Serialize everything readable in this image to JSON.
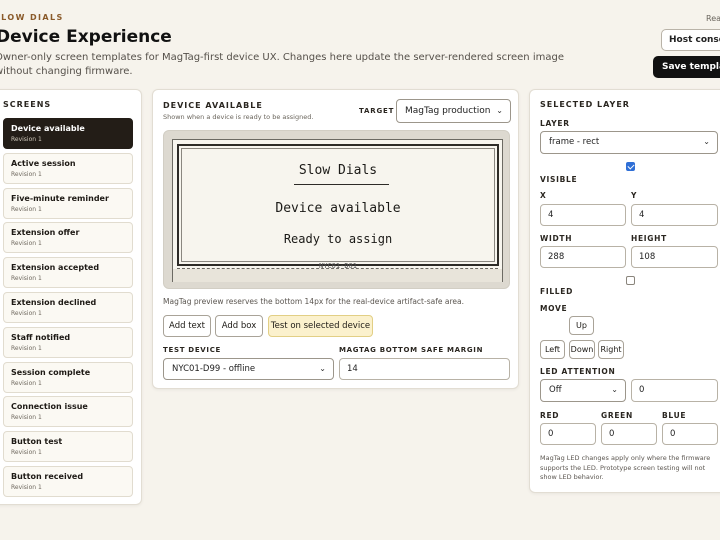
{
  "header": {
    "brand": "SLOW DIALS",
    "title": "Device Experience",
    "description": "Owner-only screen templates for MagTag-first device UX. Changes here update the server-rendered screen image without changing firmware.",
    "top_link": "Ready",
    "host_console_label": "Host console",
    "save_label": "Save templates"
  },
  "screens": {
    "label": "SCREENS",
    "items": [
      {
        "name": "Device available",
        "revision": "Revision 1",
        "active": true
      },
      {
        "name": "Active session",
        "revision": "Revision 1"
      },
      {
        "name": "Five-minute reminder",
        "revision": "Revision 1"
      },
      {
        "name": "Extension offer",
        "revision": "Revision 1"
      },
      {
        "name": "Extension accepted",
        "revision": "Revision 1"
      },
      {
        "name": "Extension declined",
        "revision": "Revision 1"
      },
      {
        "name": "Staff notified",
        "revision": "Revision 1"
      },
      {
        "name": "Session complete",
        "revision": "Revision 1"
      },
      {
        "name": "Connection issue",
        "revision": "Revision 1"
      },
      {
        "name": "Button test",
        "revision": "Revision 1"
      },
      {
        "name": "Button received",
        "revision": "Revision 1"
      }
    ]
  },
  "editor": {
    "title": "DEVICE AVAILABLE",
    "subtitle": "Shown when a device is ready to be assigned.",
    "target_label": "TARGET",
    "target_value": "MagTag production",
    "preview": {
      "title": "Slow Dials",
      "heading": "Device available",
      "subheading": "Ready to assign",
      "device_code": "NYC01-D01"
    },
    "preview_note": "MagTag preview reserves the bottom 14px for the real-device artifact-safe area.",
    "add_text_label": "Add text",
    "add_box_label": "Add box",
    "test_label": "Test on selected device",
    "test_device_label": "TEST DEVICE",
    "test_device_value": "NYC01-D99 - offline",
    "margin_label": "MAGTAG BOTTOM SAFE MARGIN",
    "margin_value": "14"
  },
  "layer": {
    "title": "SELECTED LAYER",
    "layer_label": "LAYER",
    "layer_value": "frame - rect",
    "visible_label": "VISIBLE",
    "visible_checked": true,
    "x_label": "X",
    "x_value": "4",
    "y_label": "Y",
    "y_value": "4",
    "width_label": "WIDTH",
    "width_value": "288",
    "height_label": "HEIGHT",
    "height_value": "108",
    "filled_label": "FILLED",
    "filled_checked": false,
    "move_label": "MOVE",
    "move_up": "Up",
    "move_left": "Left",
    "move_down": "Down",
    "move_right": "Right",
    "led_label": "LED ATTENTION",
    "led_mode": "Off",
    "led_value": "0",
    "red_label": "RED",
    "red_value": "0",
    "green_label": "GREEN",
    "green_value": "0",
    "blue_label": "BLUE",
    "blue_value": "0",
    "led_note": "MagTag LED changes apply only where the firmware supports the LED. Prototype screen testing will not show LED behavior."
  },
  "colors": {
    "accent_dark": "#231d17",
    "page_bg": "#f6f3ec",
    "test_button_bg": "#fbf1cd",
    "checkbox_on": "#2f6fd6"
  }
}
